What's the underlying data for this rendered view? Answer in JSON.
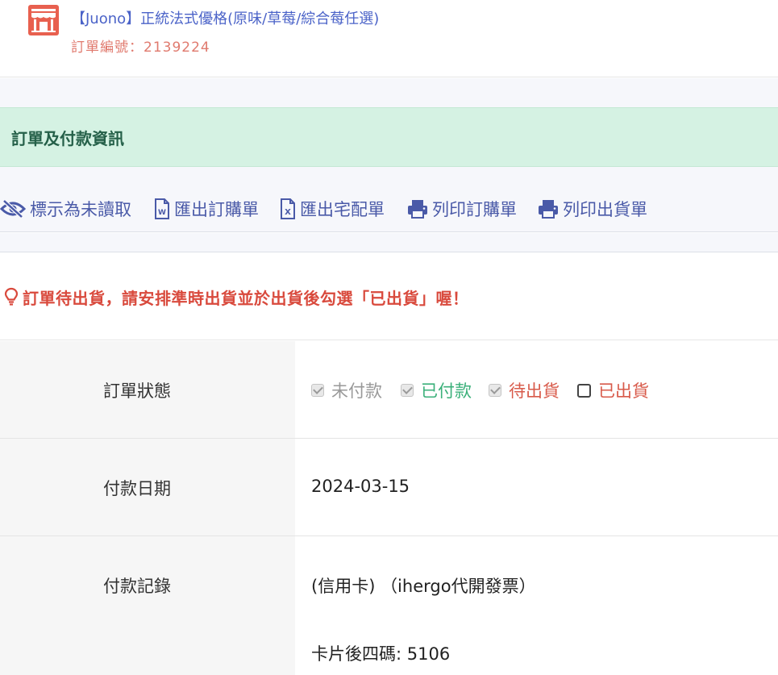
{
  "header": {
    "product_title": "【Juono】正統法式優格(原味/草莓/綜合莓任選)",
    "order_number": "訂單編號：2139224",
    "store_icon": "storefront-icon"
  },
  "section": {
    "title": "訂單及付款資訊"
  },
  "toolbar": {
    "mark_unread": "標示為未讀取",
    "export_order": "匯出訂購單",
    "export_delivery": "匯出宅配單",
    "print_order": "列印訂購單",
    "print_shipping": "列印出貨單"
  },
  "alert": {
    "icon": "lightbulb-icon",
    "text": "訂單待出貨，請安排準時出貨並於出貨後勾選「已出貨」喔！"
  },
  "details": {
    "status_label": "訂單狀態",
    "statuses": [
      {
        "label": "未付款",
        "checked": true,
        "color": "#999999"
      },
      {
        "label": "已付款",
        "checked": true,
        "color": "#3bb07a"
      },
      {
        "label": "待出貨",
        "checked": true,
        "color": "#d85a4a"
      },
      {
        "label": "已出貨",
        "checked": false,
        "color": "#d85a4a"
      }
    ],
    "payment_date_label": "付款日期",
    "payment_date": "2024-03-15",
    "payment_record_label": "付款記錄",
    "payment_method": "(信用卡) （ihergo代開發票）",
    "card_last_four": "卡片後四碼: 5106"
  },
  "colors": {
    "accent_blue": "#4b63c8",
    "toolbar_blue": "#4a5aa8",
    "section_green_bg": "#d5f2e3",
    "section_green_text": "#256049",
    "alert_red": "#d94a3d",
    "order_number": "#e07a6e"
  }
}
